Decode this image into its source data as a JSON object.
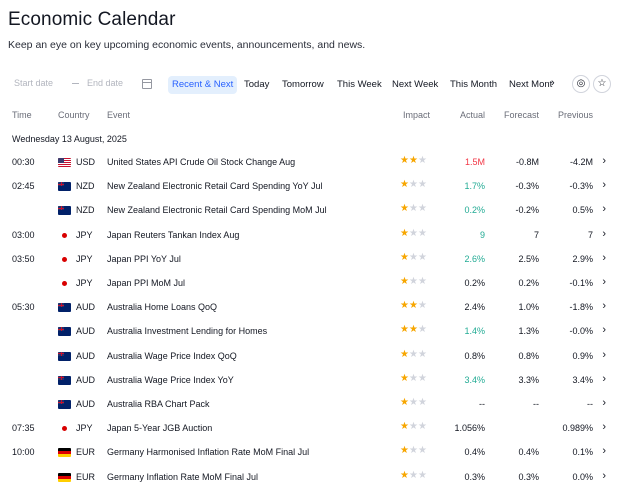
{
  "page": {
    "title": "Economic Calendar",
    "subtitle": "Keep an eye on key upcoming economic events, announcements, and news."
  },
  "filters": {
    "start_placeholder": "Start date",
    "end_placeholder": "End date",
    "tabs": [
      "Recent & Next",
      "Today",
      "Tomorrow",
      "This Week",
      "Next Week",
      "This Month",
      "Next Mont"
    ],
    "active_tab": "Recent & Next"
  },
  "table": {
    "headers": {
      "time": "Time",
      "country": "Country",
      "event": "Event",
      "impact": "Impact",
      "actual": "Actual",
      "forecast": "Forecast",
      "previous": "Previous"
    },
    "day": "Wednesday 13 August, 2025",
    "rows": [
      {
        "time": "00:30",
        "flag": "us",
        "currency": "USD",
        "event": "United States API Crude Oil Stock Change Aug",
        "impact": 2,
        "actual": "1.5M",
        "actual_tone": "red",
        "forecast": "-0.8M",
        "previous": "-4.2M"
      },
      {
        "time": "02:45",
        "flag": "nz",
        "currency": "NZD",
        "event": "New Zealand Electronic Retail Card Spending YoY Jul",
        "impact": 1,
        "actual": "1.7%",
        "actual_tone": "green",
        "forecast": "-0.3%",
        "previous": "-0.3%"
      },
      {
        "time": "",
        "flag": "nz",
        "currency": "NZD",
        "event": "New Zealand Electronic Retail Card Spending MoM Jul",
        "impact": 1,
        "actual": "0.2%",
        "actual_tone": "green",
        "forecast": "-0.2%",
        "previous": "0.5%"
      },
      {
        "time": "03:00",
        "flag": "jp",
        "currency": "JPY",
        "event": "Japan Reuters Tankan Index Aug",
        "impact": 1,
        "actual": "9",
        "actual_tone": "green",
        "forecast": "7",
        "previous": "7"
      },
      {
        "time": "03:50",
        "flag": "jp",
        "currency": "JPY",
        "event": "Japan PPI YoY Jul",
        "impact": 1,
        "actual": "2.6%",
        "actual_tone": "green",
        "forecast": "2.5%",
        "previous": "2.9%"
      },
      {
        "time": "",
        "flag": "jp",
        "currency": "JPY",
        "event": "Japan PPI MoM Jul",
        "impact": 1,
        "actual": "0.2%",
        "actual_tone": "neutral",
        "forecast": "0.2%",
        "previous": "-0.1%"
      },
      {
        "time": "05:30",
        "flag": "au",
        "currency": "AUD",
        "event": "Australia Home Loans QoQ",
        "impact": 2,
        "actual": "2.4%",
        "actual_tone": "neutral",
        "forecast": "1.0%",
        "previous": "-1.8%"
      },
      {
        "time": "",
        "flag": "au",
        "currency": "AUD",
        "event": "Australia Investment Lending for Homes",
        "impact": 2,
        "actual": "1.4%",
        "actual_tone": "green",
        "forecast": "1.3%",
        "previous": "-0.0%"
      },
      {
        "time": "",
        "flag": "au",
        "currency": "AUD",
        "event": "Australia Wage Price Index QoQ",
        "impact": 1,
        "actual": "0.8%",
        "actual_tone": "neutral",
        "forecast": "0.8%",
        "previous": "0.9%"
      },
      {
        "time": "",
        "flag": "au",
        "currency": "AUD",
        "event": "Australia Wage Price Index YoY",
        "impact": 1,
        "actual": "3.4%",
        "actual_tone": "green",
        "forecast": "3.3%",
        "previous": "3.4%"
      },
      {
        "time": "",
        "flag": "au",
        "currency": "AUD",
        "event": "Australia RBA Chart Pack",
        "impact": 1,
        "actual": "--",
        "actual_tone": "neutral",
        "forecast": "--",
        "previous": "--"
      },
      {
        "time": "07:35",
        "flag": "jp",
        "currency": "JPY",
        "event": "Japan 5-Year JGB Auction",
        "impact": 1,
        "actual": "1.056%",
        "actual_tone": "neutral",
        "forecast": "",
        "previous": "0.989%"
      },
      {
        "time": "10:00",
        "flag": "de",
        "currency": "EUR",
        "event": "Germany Harmonised Inflation Rate MoM Final Jul",
        "impact": 1,
        "actual": "0.4%",
        "actual_tone": "neutral",
        "forecast": "0.4%",
        "previous": "0.1%"
      },
      {
        "time": "",
        "flag": "de",
        "currency": "EUR",
        "event": "Germany Inflation Rate MoM Final Jul",
        "impact": 1,
        "actual": "0.3%",
        "actual_tone": "neutral",
        "forecast": "0.3%",
        "previous": "0.0%"
      }
    ]
  },
  "colors": {
    "accent": "#2962ff",
    "positive": "#22ab94",
    "negative": "#f23645",
    "impact_star": "#f7a600"
  }
}
